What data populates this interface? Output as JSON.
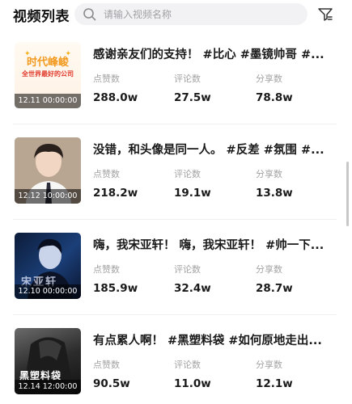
{
  "header": {
    "title": "视频列表",
    "search_placeholder": "请输入视频名称"
  },
  "stat_labels": {
    "likes": "点赞数",
    "comments": "评论数",
    "shares": "分享数"
  },
  "videos": [
    {
      "title": "感谢亲友们的支持！ #比心 #墨镜帅哥 #...",
      "date": "12.11 00:00:00",
      "thumb_text": "时代峰峻",
      "thumb_subtext": "全世界最好的公司",
      "likes": "288.0w",
      "comments": "27.5w",
      "shares": "78.8w"
    },
    {
      "title": "没错，和头像是同一人。 #反差 #氛围 #...",
      "date": "12.12 10:00:00",
      "likes": "218.2w",
      "comments": "19.1w",
      "shares": "13.8w"
    },
    {
      "title": "嗨，我宋亚轩！ 嗨，我宋亚轩！ #帅一下...",
      "date": "12.10 00:00:00",
      "thumb_text": "宋亚轩",
      "likes": "185.9w",
      "comments": "32.4w",
      "shares": "28.7w"
    },
    {
      "title": "有点累人啊！ #黑塑料袋 #如何原地走出...",
      "date": "12.14 12:00:00",
      "thumb_text": "黑塑料袋",
      "likes": "90.5w",
      "comments": "11.0w",
      "shares": "12.1w"
    }
  ]
}
